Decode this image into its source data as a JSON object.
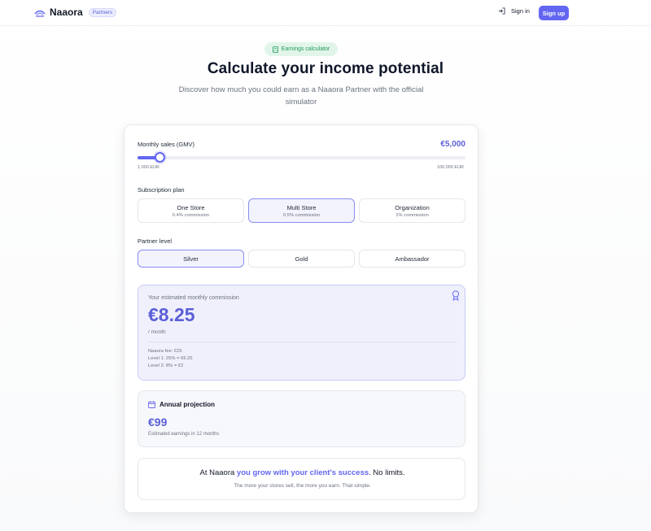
{
  "header": {
    "brand": "Naaora",
    "badge": "Partners",
    "sign_in": "Sign in",
    "sign_up": "Sign up"
  },
  "hero": {
    "pill": "Earnings calculator",
    "title": "Calculate your income potential",
    "subtitle": "Discover how much you could earn as a Naaora Partner with the official simulator"
  },
  "calculator": {
    "gmv_label": "Monthly sales (GMV)",
    "gmv_value": "€5,000",
    "slider": {
      "min_label": "1.000 EUR",
      "max_label": "100.000 EUR",
      "fraction": 0.05
    },
    "plan_label": "Subscription plan",
    "plans": [
      {
        "title": "One Store",
        "sub": "0.4% commission"
      },
      {
        "title": "Multi Store",
        "sub": "0.5% commission"
      },
      {
        "title": "Organization",
        "sub": "1% commission"
      }
    ],
    "level_label": "Partner level",
    "levels": [
      "Silver",
      "Gold",
      "Ambassador"
    ]
  },
  "commission": {
    "caption": "Your estimated monthly commission",
    "amount": "€8.25",
    "period": "/ month",
    "breakdown": [
      "Naaora fee: €25",
      "Level 1: 25% = €6.25",
      "Level 2: 8% = €2"
    ]
  },
  "annual": {
    "title": "Annual projection",
    "amount": "€99",
    "caption": "Estimated earnings in 12 months"
  },
  "tagline": {
    "prefix": "At Naaora ",
    "highlight": "you grow with your client's success",
    "suffix": ". No limits.",
    "sub": "The more your stores sell, the more you earn. That simple."
  },
  "colors": {
    "accent": "#6366f1",
    "success": "#1e9a55"
  }
}
